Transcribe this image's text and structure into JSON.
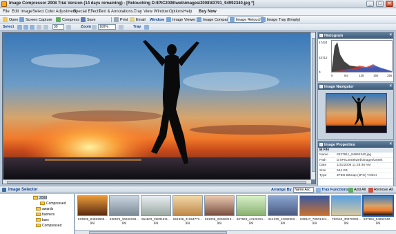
{
  "window": {
    "title": "Image Compressor 2008 Trial Version (14 days remaining) - [Retouching D:\\IPIC2008\\web\\images\\2008\\83791_94992340.jpg *]"
  },
  "menu": {
    "items": [
      "File",
      "Edit",
      "Image",
      "Select",
      "Color Adjustment",
      "Special Effects",
      "Text & Annotations...",
      "Tray",
      "View",
      "Window",
      "Options",
      "Help"
    ],
    "buy_now": "Buy Now"
  },
  "toolbar1": {
    "open": "Open",
    "screen_capture": "Screen Capture",
    "compress": "Compress",
    "save": "Save",
    "print": "Print",
    "email": "Email",
    "window_label": "Window",
    "tabs": [
      "Image Viewer",
      "Image Compare",
      "Image Retouch",
      "Image Tray (Empty)"
    ]
  },
  "toolbar2": {
    "select_label": "Select",
    "size_value": "30",
    "zoom_label": "Zoom",
    "zoom_value": "100%",
    "tray_label": "Tray"
  },
  "histogram": {
    "title": "Histogram",
    "y_max": "47424",
    "y_mid": "23712",
    "y_min": "0",
    "x_ticks": [
      "0",
      "64",
      "128",
      "192",
      "255"
    ]
  },
  "navigator": {
    "title": "Image Navigator"
  },
  "properties": {
    "title": "Image Properties",
    "group": "File",
    "rows": [
      {
        "key": "Name",
        "value": "8337911_94992340.jpg"
      },
      {
        "key": "Path",
        "value": "D:\\IPIC2008\\web\\images\\2008\\"
      },
      {
        "key": "Date",
        "value": "1/31/2008 11:28:46 AM"
      },
      {
        "key": "Size",
        "value": "644 KB"
      },
      {
        "key": "Type",
        "value": "JPEG Bitmap (JPG) YCbCr"
      }
    ]
  },
  "selector": {
    "title": "Image Selector",
    "arrange_by": "Arrange By",
    "sort_value": "Name Asc",
    "tray_functions": "Tray Functions",
    "add_all": "Add All",
    "remove_all": "Remove All"
  },
  "tree": {
    "items": [
      "2008",
      "Compressed",
      "awards",
      "banners",
      "bars",
      "Compressed"
    ]
  },
  "thumbnails": [
    {
      "name": "523036_84883809...",
      "ext": "jpg"
    },
    {
      "name": "536575_36260199...",
      "ext": "jpg"
    },
    {
      "name": "554803_29831611...",
      "ext": "jpg"
    },
    {
      "name": "561938_41084772...",
      "ext": "jpg"
    },
    {
      "name": "581009_22066213...",
      "ext": "jpg"
    },
    {
      "name": "607963_44128321...",
      "ext": "jpg"
    },
    {
      "name": "614230_13283352...",
      "ext": "jpg"
    },
    {
      "name": "633847_78001424...",
      "ext": "jpg"
    },
    {
      "name": "792152_30370030...",
      "ext": "jpg"
    },
    {
      "name": "837891_94992340...",
      "ext": "jpg"
    }
  ],
  "colors": {
    "accent": "#0b3d91",
    "panel_header": "#4a6a8b"
  }
}
